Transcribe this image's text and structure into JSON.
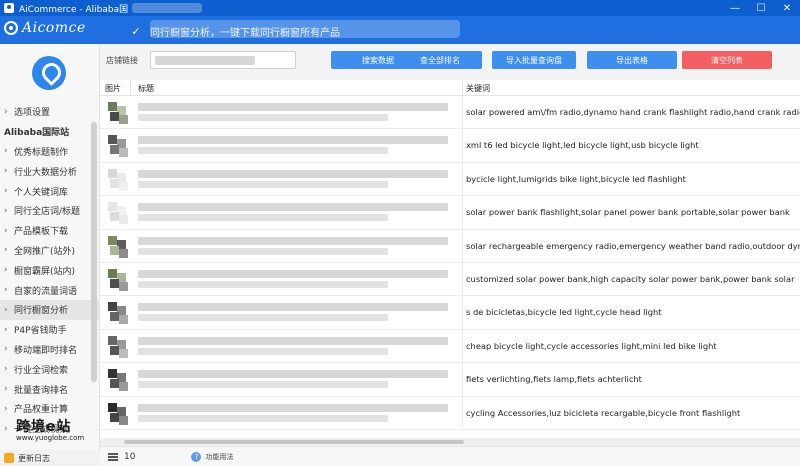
{
  "window": {
    "title": "AiCommerce - Alibaba国",
    "controls": {
      "minimize": "—",
      "maximize": "☐",
      "close": "✕"
    }
  },
  "header": {
    "brand": "Aicomce",
    "banner": "同行橱窗分析，一键下载同行橱窗所有产品"
  },
  "sidebar": {
    "items": [
      {
        "label": "选项设置",
        "type": "item"
      },
      {
        "label": "Alibaba国际站",
        "type": "section"
      },
      {
        "label": "优秀标题制作",
        "type": "item"
      },
      {
        "label": "行业大数据分析",
        "type": "item"
      },
      {
        "label": "个人关键词库",
        "type": "item"
      },
      {
        "label": "同行全店词/标题",
        "type": "item"
      },
      {
        "label": "产品模板下载",
        "type": "item"
      },
      {
        "label": "全网推广(站外)",
        "type": "item"
      },
      {
        "label": "橱窗霸屏(站内)",
        "type": "item"
      },
      {
        "label": "自家的流量词语",
        "type": "item"
      },
      {
        "label": "同行橱窗分析",
        "type": "item",
        "active": true
      },
      {
        "label": "P4P省钱助手",
        "type": "item"
      },
      {
        "label": "移动端即时排名",
        "type": "item"
      },
      {
        "label": "行业全词检索",
        "type": "item"
      },
      {
        "label": "批量查询排名",
        "type": "item"
      },
      {
        "label": "产品权重计算",
        "type": "item"
      },
      {
        "label": "一键生成视频",
        "type": "item"
      }
    ],
    "bottom_label": "更新日志",
    "watermark_main": "跨境e站",
    "watermark_url": "www.yuoglobe.com"
  },
  "toolbar": {
    "shop_label": "店铺链接",
    "shop_input_value": "",
    "buttons": [
      {
        "label": "搜索数据",
        "style": "primary"
      },
      {
        "label": "查全部排名",
        "style": "primary"
      },
      {
        "label": "导入批量查询盘",
        "style": "primary"
      },
      {
        "label": "导出表格",
        "style": "primary"
      },
      {
        "label": "清空列表",
        "style": "danger"
      }
    ]
  },
  "table": {
    "columns": [
      "图片",
      "标题",
      "关键词"
    ],
    "rows": [
      {
        "keywords": "solar powered am\\/fm radio,dynamo hand crank flashlight radio,hand crank radio"
      },
      {
        "keywords": "xml t6 led bicycle light,led bicycle light,usb bicycle light"
      },
      {
        "keywords": "bycicle light,lumigrids bike light,bicycle led flashlight"
      },
      {
        "keywords": "solar power bank flashlight,solar panel power bank portable,solar power bank"
      },
      {
        "keywords": "solar rechargeable emergency radio,emergency weather band radio,outdoor dynamo"
      },
      {
        "keywords": "customized solar power bank,high capacity solar power bank,power bank solar"
      },
      {
        "keywords": "s de bicicletas,bicycle led light,cycle head light"
      },
      {
        "keywords": "cheap bicycle light,cycle accessories light,mini led bike light"
      },
      {
        "keywords": "fiets verlichting,fiets lamp,fiets achterlicht"
      },
      {
        "keywords": "cycling Accessories,luz bicicleta recargable,bicycle front flashlight"
      }
    ]
  },
  "footer": {
    "count": "10",
    "help_label": "功能用法"
  },
  "colors": {
    "titlebar": "#0d5fd0",
    "header": "#1f6fe0",
    "button_primary": "#3d8fef",
    "button_danger": "#f35e63"
  }
}
